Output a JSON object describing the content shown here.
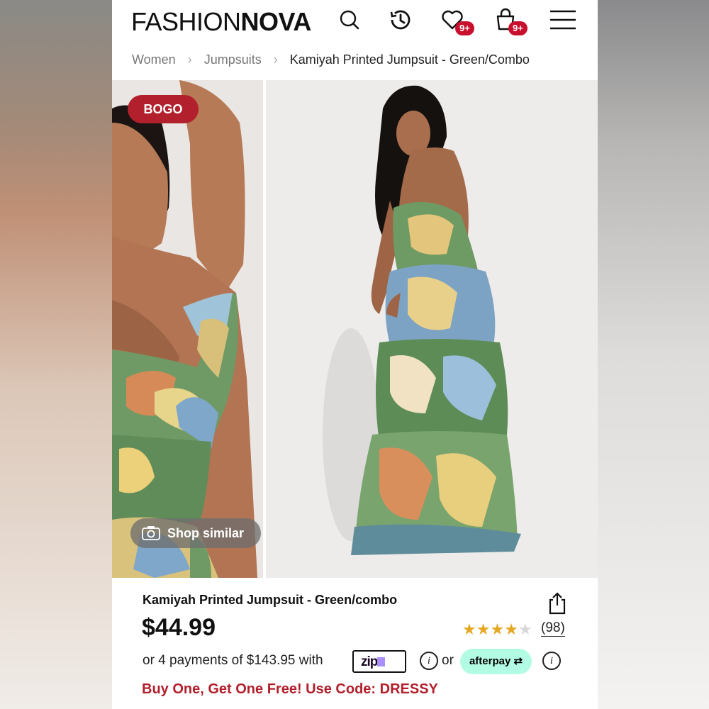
{
  "header": {
    "logo_thin": "FASHION",
    "logo_bold": "NOVA",
    "wishlist_badge": "9+",
    "cart_badge": "9+"
  },
  "breadcrumb": {
    "items": [
      "Women",
      "Jumpsuits",
      "Kamiyah Printed Jumpsuit - Green/Combo"
    ]
  },
  "gallery": {
    "promo_badge": "BOGO",
    "shop_similar": "Shop similar"
  },
  "product": {
    "title": "Kamiyah Printed Jumpsuit - Green/combo",
    "price": "$44.99",
    "rating": 4,
    "rating_max": 5,
    "review_count": "(98)",
    "installments_text": "or 4 payments of $143.95 with",
    "zip_label": "zip",
    "or_text": "or",
    "afterpay_label": "afterpay",
    "promo_text": "Buy One, Get One Free! Use Code: DRESSY"
  },
  "colors": {
    "accent_red": "#b1202c",
    "badge_red": "#c8102e",
    "star_gold": "#e5a823",
    "afterpay_mint": "#b2fce4"
  },
  "icons": [
    "search-icon",
    "history-icon",
    "heart-icon",
    "bag-icon",
    "menu-icon",
    "camera-icon",
    "share-icon",
    "info-icon",
    "chevron-right-icon"
  ]
}
